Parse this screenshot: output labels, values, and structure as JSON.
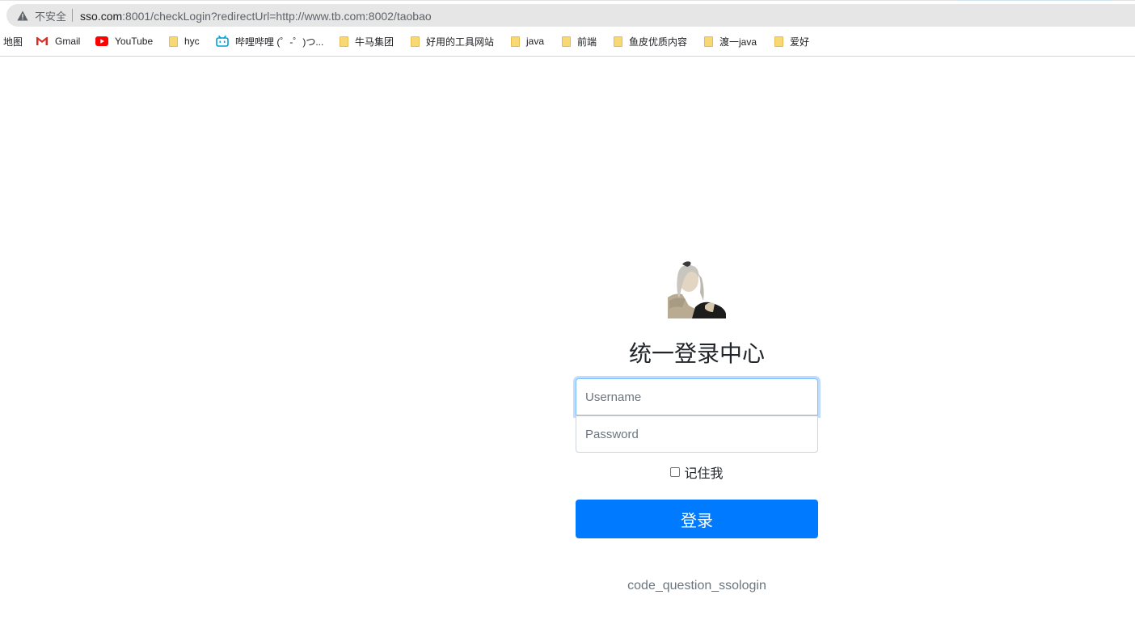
{
  "address_bar": {
    "security_label": "不安全",
    "url_host": "sso.com",
    "url_rest": ":8001/checkLogin?redirectUrl=http://www.tb.com:8002/taobao"
  },
  "bookmarks": [
    {
      "label": "地图",
      "icon": "none"
    },
    {
      "label": "Gmail",
      "icon": "gmail-icon"
    },
    {
      "label": "YouTube",
      "icon": "youtube-icon"
    },
    {
      "label": "hyc",
      "icon": "folder-icon"
    },
    {
      "label": "哔哩哔哩 (゜-゜)つ...",
      "icon": "bilibili-icon"
    },
    {
      "label": "牛马集团",
      "icon": "folder-icon"
    },
    {
      "label": "好用的工具网站",
      "icon": "folder-icon"
    },
    {
      "label": "java",
      "icon": "folder-icon"
    },
    {
      "label": "前端",
      "icon": "folder-icon"
    },
    {
      "label": "鱼皮优质内容",
      "icon": "folder-icon"
    },
    {
      "label": "渡一java",
      "icon": "folder-icon"
    },
    {
      "label": "爱好",
      "icon": "folder-icon"
    }
  ],
  "login": {
    "title": "统一登录中心",
    "username_placeholder": "Username",
    "password_placeholder": "Password",
    "remember_label": "记住我",
    "submit_label": "登录",
    "footer": "code_question_ssologin"
  },
  "colors": {
    "primary": "#007bff",
    "focus_border": "#80bdff",
    "muted_text": "#6c757d"
  }
}
